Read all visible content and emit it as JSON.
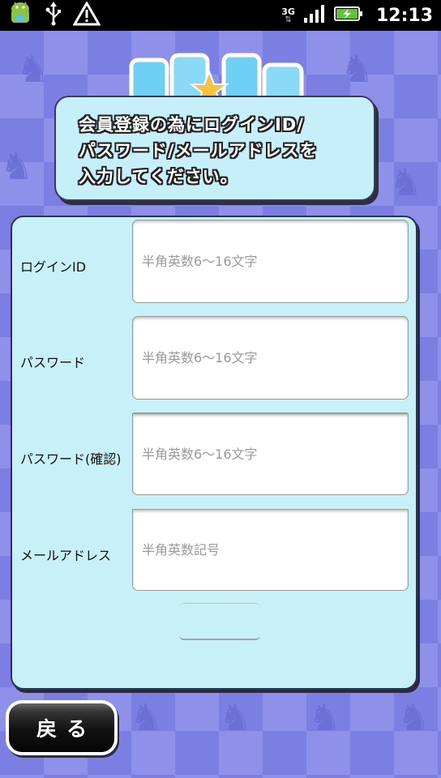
{
  "status_bar": {
    "network_type": "3G",
    "time": "12:13",
    "icons": [
      "android-icon",
      "usb-icon",
      "warning-icon",
      "signal-icon",
      "battery-charging-icon"
    ]
  },
  "header": {
    "logo_name": "app-logo"
  },
  "instruction": {
    "text": "会員登録の為にログインID/\nパスワード/メールアドレスを\n入力してください。"
  },
  "form": {
    "fields": [
      {
        "label": "ログインID",
        "placeholder": "半角英数6〜16文字",
        "value": ""
      },
      {
        "label": "パスワード",
        "placeholder": "半角英数6〜16文字",
        "value": ""
      },
      {
        "label": "パスワード(確認)",
        "placeholder": "半角英数6〜16文字",
        "value": ""
      },
      {
        "label": "メールアドレス",
        "placeholder": "半角英数記号",
        "value": ""
      }
    ],
    "submit_label": ""
  },
  "footer": {
    "back_label": "戻る"
  },
  "colors": {
    "background": "#7c7fe2",
    "panel": "#c8f0f8",
    "bubble": "#c7effa",
    "border": "#303050"
  }
}
